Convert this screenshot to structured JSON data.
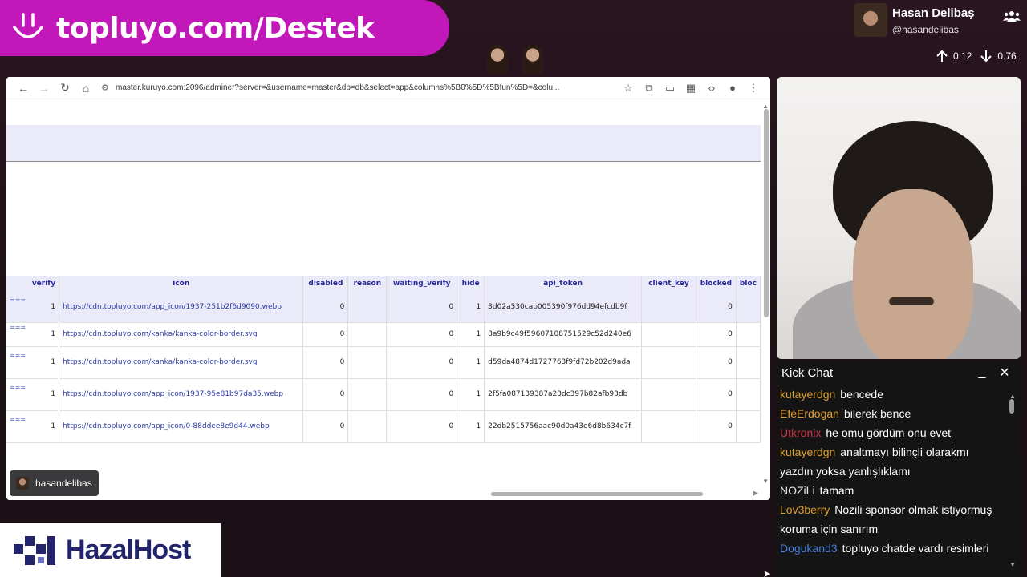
{
  "banner": {
    "text": "topluyo.com/Destek",
    "logo_icon": "smile-logo"
  },
  "profile": {
    "name": "Hasan Delibaş",
    "handle": "@hasandelibas",
    "group_icon": "users-icon"
  },
  "net": {
    "up": "0.12",
    "down": "0.76"
  },
  "browser": {
    "url": "master.kuruyo.com:2096/adminer?server=&username=master&db=db&select=app&columns%5B0%5D%5Bfun%5D=&colu...",
    "table": {
      "headers": [
        "verify",
        "icon",
        "disabled",
        "reason",
        "waiting_verify",
        "hide",
        "api_token",
        "client_key",
        "blocked",
        "bloc"
      ],
      "rows": [
        [
          "1",
          "https://cdn.topluyo.com/app_icon/1937-251b2f6d9090.webp",
          "0",
          "",
          "0",
          "1",
          "3d02a530cab005390f976dd94efcdb9f",
          "",
          "0",
          ""
        ],
        [
          "1",
          "https://cdn.topluyo.com/kanka/kanka-color-border.svg",
          "0",
          "",
          "0",
          "1",
          "8a9b9c49f59607108751529c52d240e6",
          "",
          "0",
          ""
        ],
        [
          "1",
          "https://cdn.topluyo.com/kanka/kanka-color-border.svg",
          "0",
          "",
          "0",
          "1",
          "d59da4874d1727763f9fd72b202d9ada",
          "",
          "0",
          ""
        ],
        [
          "1",
          "https://cdn.topluyo.com/app_icon/1937-95e81b97da35.webp",
          "0",
          "",
          "0",
          "1",
          "2f5fa087139387a23dc397b82afb93db",
          "",
          "0",
          ""
        ],
        [
          "1",
          "https://cdn.topluyo.com/app_icon/0-88ddee8e9d44.webp",
          "0",
          "",
          "0",
          "1",
          "22db2515756aac90d0a43e6d8b634c7f",
          "",
          "0",
          ""
        ]
      ]
    }
  },
  "user_badge": {
    "name": "hasandelibas"
  },
  "chat": {
    "title": "Kick Chat",
    "messages": [
      {
        "user": "kutayerdgn",
        "color": "#e0a030",
        "text": "bencede"
      },
      {
        "user": "EfeErdogan",
        "color": "#e0a030",
        "text": "bilerek bence"
      },
      {
        "user": "Utkronix",
        "color": "#c83848",
        "text": "he omu gördüm onu evet"
      },
      {
        "user": "kutayerdgn",
        "color": "#e0a030",
        "text": "analtmayı bilinçli olarakmı yazdın yoksa yanlışlıklamı"
      },
      {
        "user": "NOZiLi",
        "color": "#e8e8e8",
        "text": "tamam"
      },
      {
        "user": "Lov3berry",
        "color": "#e0a030",
        "text": "Nozili sponsor olmak istiyormuş koruma için sanırım"
      },
      {
        "user": "Dogukand3",
        "color": "#4a7fe0",
        "text": "topluyo chatde vardı resimleri"
      }
    ]
  },
  "sponsor": {
    "name": "HazalHost",
    "brand_color": "#22256b"
  }
}
